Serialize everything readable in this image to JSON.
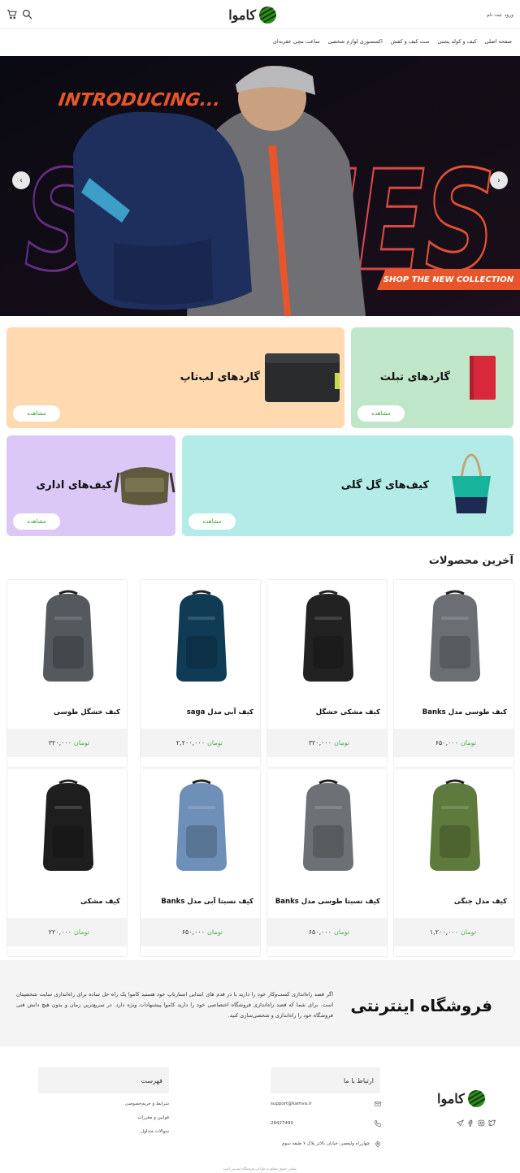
{
  "header": {
    "auth": {
      "login": "ورود",
      "register": "ثبت نام"
    },
    "logo_text": "کاموا",
    "icons": [
      "search-icon",
      "cart-icon"
    ]
  },
  "nav": {
    "items": [
      "صفحه اصلی",
      "کیف و کوله پشتی",
      "ست کیف و کفش",
      "اکسسوری لوازم شخصی",
      "ساعت مچی عقربه‌ای"
    ]
  },
  "hero": {
    "headline": "INTRODUCING...",
    "big_text": "STORIES",
    "cta_text": "SHOP THE NEW COLLECTION",
    "colors": {
      "headline": "#e8552a",
      "cta_bg": "#e8552a"
    }
  },
  "categories": [
    {
      "title": "گاردهای تبلت",
      "button": "مشاهده",
      "bg": "#bfe6c8"
    },
    {
      "title": "گاردهای لب‌تاپ",
      "button": "مشاهده",
      "bg": "#ffd9b0"
    },
    {
      "title": "کیف‌های گل گلی",
      "button": "مشاهده",
      "bg": "#b3ebe7"
    },
    {
      "title": "کیف‌های اداری",
      "button": "مشاهده",
      "bg": "#dcc8f7"
    }
  ],
  "latest": {
    "title": "آخرین محصولات",
    "products": [
      {
        "name": "کیف طوسی مدل Banks",
        "price": "۶۵۰,۰۰۰",
        "currency": "تومان",
        "color": "#6b6f73"
      },
      {
        "name": "کیف مشکی خشگل",
        "price": "۳۲۰,۰۰۰",
        "currency": "تومان",
        "color": "#222222"
      },
      {
        "name": "کیف آبی مدل saga",
        "price": "۲,۲۰۰,۰۰۰",
        "currency": "تومان",
        "color": "#0f3b55"
      },
      {
        "name": "کیف خشگل طوسی",
        "price": "۳۲۰,۰۰۰",
        "currency": "تومان",
        "color": "#55585c"
      },
      {
        "name": "کیف مدل جنگی",
        "price": "۱,۲۰۰,۰۰۰",
        "currency": "تومان",
        "color": "#5e7a3c"
      },
      {
        "name": "کیف نسبتا طوسی مدل Banks",
        "price": "۶۵۰,۰۰۰",
        "currency": "تومان",
        "color": "#6d7175"
      },
      {
        "name": "کیف نسبتا آبی مدل Banks",
        "price": "۶۵۰,۰۰۰",
        "currency": "تومان",
        "color": "#6d8fb8"
      },
      {
        "name": "کیف مشکی",
        "price": "۲۲۰,۰۰۰",
        "currency": "تومان",
        "color": "#1e1e1e"
      }
    ]
  },
  "about": {
    "title": "فروشگاه اینترنتی",
    "text": "اگر قصد راه‌اندازی کسب‌وکار خود را دارید یا در قدم های ابتدایی استارتاپ خود هستید کاموا یک راه حل ساده برای راه‌اندازی سایت شخصیتان است. برای شما که قصد راه‌اندازی فروشگاه اختصاصی خود را دارید کاموا پیشنهادات ویژه دارد. در سریع‌ترین زمان و بدون هیچ دانش فنی فروشگاه خود را راه‌اندازی و شخصی‌سازی کنید."
  },
  "footer": {
    "logo_text": "کاموا",
    "contact": {
      "title": "ارتباط با ما",
      "email": "support@kamva.ir",
      "phone": "28427490",
      "address": "چهارراه ولیعصر، خیابان بالاتر پلاک ۷ طبقه سوم"
    },
    "menu": {
      "title": "فهرست",
      "items": [
        "شرایط و حریم‌خصوصی",
        "قوانین و مقررات",
        "سوالات متداول"
      ]
    },
    "social": [
      "telegram-icon",
      "facebook-icon",
      "instagram-icon",
      "twitter-icon"
    ],
    "copyright": "تمامی حقوق متعلق به طراحی فروشگاه اینترنتی است."
  }
}
